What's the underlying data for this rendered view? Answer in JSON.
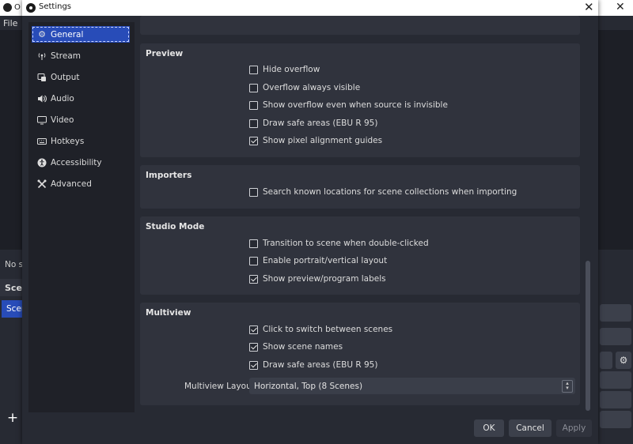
{
  "background_window": {
    "title": "O",
    "menu_file": "File",
    "status_text": "No s",
    "scenes_header": "Scer",
    "scene_item": "Scer"
  },
  "dialog": {
    "title": "Settings",
    "close_glyph": "✕"
  },
  "sidebar": {
    "items": [
      {
        "label": "General",
        "icon": "gear-icon",
        "selected": true
      },
      {
        "label": "Stream",
        "icon": "antenna-icon"
      },
      {
        "label": "Output",
        "icon": "output-icon"
      },
      {
        "label": "Audio",
        "icon": "speaker-icon"
      },
      {
        "label": "Video",
        "icon": "monitor-icon"
      },
      {
        "label": "Hotkeys",
        "icon": "keyboard-icon"
      },
      {
        "label": "Accessibility",
        "icon": "accessibility-icon"
      },
      {
        "label": "Advanced",
        "icon": "tools-icon"
      }
    ]
  },
  "preview": {
    "title": "Preview",
    "options": [
      {
        "label": "Hide overflow",
        "checked": false
      },
      {
        "label": "Overflow always visible",
        "checked": false
      },
      {
        "label": "Show overflow even when source is invisible",
        "checked": false
      },
      {
        "label": "Draw safe areas (EBU R 95)",
        "checked": false
      },
      {
        "label": "Show pixel alignment guides",
        "checked": true
      }
    ]
  },
  "importers": {
    "title": "Importers",
    "options": [
      {
        "label": "Search known locations for scene collections when importing",
        "checked": false
      }
    ]
  },
  "studio_mode": {
    "title": "Studio Mode",
    "options": [
      {
        "label": "Transition to scene when double-clicked",
        "checked": false
      },
      {
        "label": "Enable portrait/vertical layout",
        "checked": false
      },
      {
        "label": "Show preview/program labels",
        "checked": true
      }
    ]
  },
  "multiview": {
    "title": "Multiview",
    "options": [
      {
        "label": "Click to switch between scenes",
        "checked": true
      },
      {
        "label": "Show scene names",
        "checked": true
      },
      {
        "label": "Draw safe areas (EBU R 95)",
        "checked": true
      }
    ],
    "layout_label": "Multiview Layout",
    "layout_value": "Horizontal, Top (8 Scenes)"
  },
  "buttons": {
    "ok": "OK",
    "cancel": "Cancel",
    "apply": "Apply"
  },
  "colors": {
    "accent": "#284cb8",
    "panel": "#30333d",
    "background": "#272a33"
  }
}
